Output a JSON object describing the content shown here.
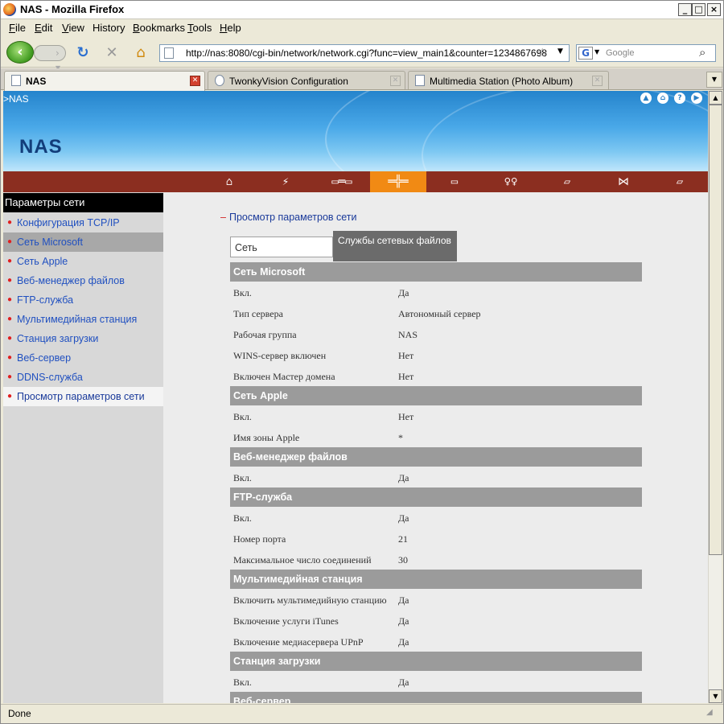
{
  "window": {
    "title": "NAS - Mozilla Firefox",
    "minimize": "_",
    "maximize": "□",
    "close": "×"
  },
  "menubar": {
    "items": [
      {
        "first": "F",
        "rest": "ile"
      },
      {
        "first": "E",
        "rest": "dit"
      },
      {
        "first": "V",
        "rest": "iew"
      },
      {
        "first": "",
        "rest": "History",
        "u": "H",
        "tail": "istory"
      },
      {
        "first": "B",
        "rest": "ookmarks"
      },
      {
        "first": "T",
        "rest": "ools"
      },
      {
        "first": "H",
        "rest": "elp"
      }
    ]
  },
  "navbar": {
    "back": "‹",
    "forward": "›",
    "url": "http://nas:8080/cgi-bin/network/network.cgi?func=view_main1&counter=1234867698",
    "search_placeholder": "Google",
    "search_engine": "G"
  },
  "tabs": [
    {
      "label": "NAS",
      "active": true
    },
    {
      "label": "TwonkyVision Configuration",
      "active": false
    },
    {
      "label": "Multimedia Station (Photo Album)",
      "active": false
    }
  ],
  "banner": {
    "breadcrumb": ">NAS",
    "logo": "NAS",
    "icons": [
      "home-circle-icon",
      "home-icon",
      "help-icon",
      "forward-icon"
    ]
  },
  "menustrip": {
    "icons": [
      "home-outline-icon",
      "lightning-icon",
      "server-icon",
      "network-icon",
      "disk-icon",
      "users-icon",
      "folder-icon",
      "bowtie-icon",
      "note-icon"
    ],
    "active_index": 3
  },
  "sidebar": {
    "heading": "Параметры сети",
    "items": [
      {
        "label": "Конфигурация TCP/IP"
      },
      {
        "label": "Сеть Microsoft"
      },
      {
        "label": "Сеть Apple"
      },
      {
        "label": "Веб-менеджер файлов"
      },
      {
        "label": "FTP-служба"
      },
      {
        "label": "Мультимедийная станция"
      },
      {
        "label": "Станция загрузки"
      },
      {
        "label": "Веб-сервер"
      },
      {
        "label": "DDNS-служба"
      },
      {
        "label": "Просмотр параметров сети"
      }
    ]
  },
  "main": {
    "view_link": "Просмотр параметров сети",
    "tab_network": "Сеть",
    "tab_services": "Службы сетевых файлов",
    "sections": [
      {
        "title": "Сеть Microsoft",
        "rows": [
          {
            "label": "Вкл.",
            "value": "Да"
          },
          {
            "label": "Тип сервера",
            "value": "Автономный сервер"
          },
          {
            "label": "Рабочая группа",
            "value": "NAS"
          },
          {
            "label": "WINS-сервер включен",
            "value": "Нет"
          },
          {
            "label": "Включен Мастер домена",
            "value": "Нет"
          }
        ]
      },
      {
        "title": "Сеть Apple",
        "rows": [
          {
            "label": "Вкл.",
            "value": "Нет"
          },
          {
            "label": "Имя зоны Apple",
            "value": "*"
          }
        ]
      },
      {
        "title": "Веб-менеджер файлов",
        "rows": [
          {
            "label": "Вкл.",
            "value": "Да"
          }
        ]
      },
      {
        "title": "FTP-служба",
        "rows": [
          {
            "label": "Вкл.",
            "value": "Да"
          },
          {
            "label": "Номер порта",
            "value": "21"
          },
          {
            "label": "Максимальное число соединений",
            "value": "30"
          }
        ]
      },
      {
        "title": "Мультимедийная станция",
        "rows": [
          {
            "label": "Включить мультимедийную станцию",
            "value": "Да"
          },
          {
            "label": "Включение услуги iTunes",
            "value": "Да"
          },
          {
            "label": "Включение медиасервера UPnP",
            "value": "Да"
          }
        ]
      },
      {
        "title": "Станция загрузки",
        "rows": [
          {
            "label": "Вкл.",
            "value": "Да"
          }
        ]
      },
      {
        "title": "Веб-сервер",
        "rows": []
      }
    ]
  },
  "status": {
    "text": "Done"
  }
}
